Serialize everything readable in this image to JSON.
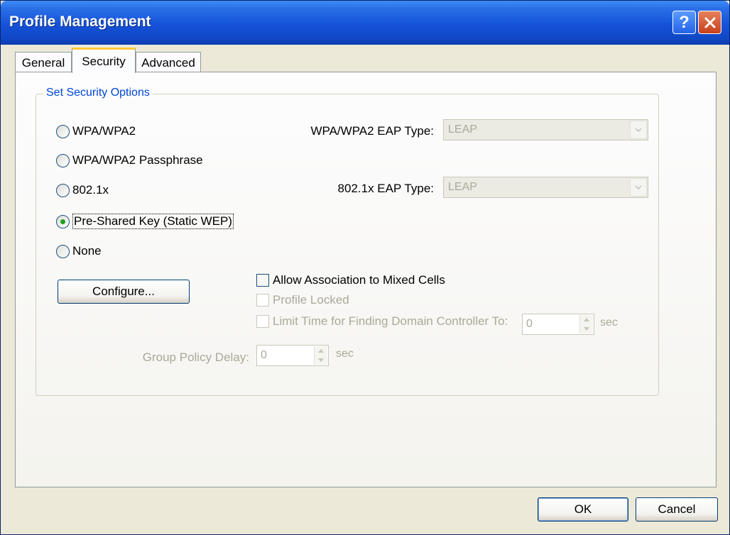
{
  "window": {
    "title": "Profile Management",
    "help_glyph": "?",
    "close_glyph": "×"
  },
  "tabs": [
    {
      "label": "General",
      "selected": false
    },
    {
      "label": "Security",
      "selected": true
    },
    {
      "label": "Advanced",
      "selected": false
    }
  ],
  "security_group": {
    "legend": "Set Security Options",
    "options": [
      {
        "label": "WPA/WPA2",
        "checked": false
      },
      {
        "label": "WPA/WPA2 Passphrase",
        "checked": false
      },
      {
        "label": "802.1x",
        "checked": false
      },
      {
        "label": "Pre-Shared Key (Static WEP)",
        "checked": true
      },
      {
        "label": "None",
        "checked": false
      }
    ],
    "wpa_eap": {
      "label": "WPA/WPA2 EAP Type:",
      "value": "LEAP"
    },
    "dot1x_eap": {
      "label": "802.1x EAP Type:",
      "value": "LEAP"
    },
    "configure_label": "Configure...",
    "allow_mixed": {
      "label": "Allow Association to Mixed Cells",
      "checked": false
    },
    "profile_locked": {
      "label": "Profile Locked",
      "checked": false
    },
    "limit_time": {
      "label": "Limit Time for Finding Domain Controller To:",
      "value": "0",
      "unit": "sec"
    },
    "group_policy": {
      "label": "Group Policy Delay:",
      "value": "0",
      "unit": "sec"
    }
  },
  "footer": {
    "ok_label": "OK",
    "cancel_label": "Cancel"
  },
  "colors": {
    "title_bar": "#1552d8",
    "accent_legend": "#0046d5",
    "selected_radio_dot": "#21a121",
    "dialog_bg": "#ece9d8"
  }
}
